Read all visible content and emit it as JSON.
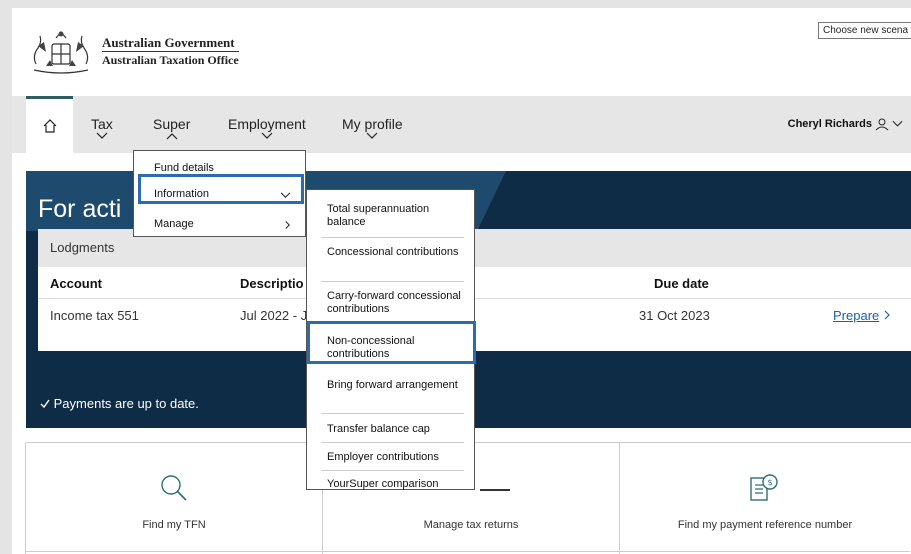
{
  "header": {
    "scenario_button": "Choose new scena",
    "logo_line1": "Australian Government",
    "logo_line2": "Australian Taxation Office"
  },
  "nav": {
    "items": [
      {
        "label": "Tax"
      },
      {
        "label": "Super"
      },
      {
        "label": "Employment"
      },
      {
        "label": "My profile"
      }
    ],
    "user_name": "Cheryl Richards"
  },
  "banner": {
    "title": "For acti",
    "lodgments_heading": "Lodgments",
    "columns": {
      "account": "Account",
      "description": "Descriptio",
      "due_date": "Due date"
    },
    "row": {
      "account": "Income tax 551",
      "description": "Jul 2022 - J",
      "due_date": "31 Oct 2023",
      "action": "Prepare"
    },
    "payments": "Payments are up to date."
  },
  "tiles": [
    {
      "label": "Find my TFN",
      "icon": "magnifier-icon"
    },
    {
      "label": "Manage tax returns",
      "icon": "dash-icon"
    },
    {
      "label": "Find my payment reference number",
      "icon": "document-dollar-icon"
    }
  ],
  "super_menu": {
    "items": [
      "Fund details",
      "Information",
      "Manage"
    ],
    "selected": "Information"
  },
  "information_menu": {
    "items": [
      "Total superannuation balance",
      "Concessional contributions",
      "Carry-forward concessional contributions",
      "Non-concessional contributions",
      "Bring forward arrangement",
      "Transfer balance cap",
      "Employer contributions",
      "YourSuper comparison"
    ],
    "selected": "Non-concessional contributions"
  },
  "colors": {
    "banner": "#0f2c47",
    "highlight": "#2b6cb0",
    "link": "#1f5fa8",
    "accent": "#2f5d62"
  }
}
